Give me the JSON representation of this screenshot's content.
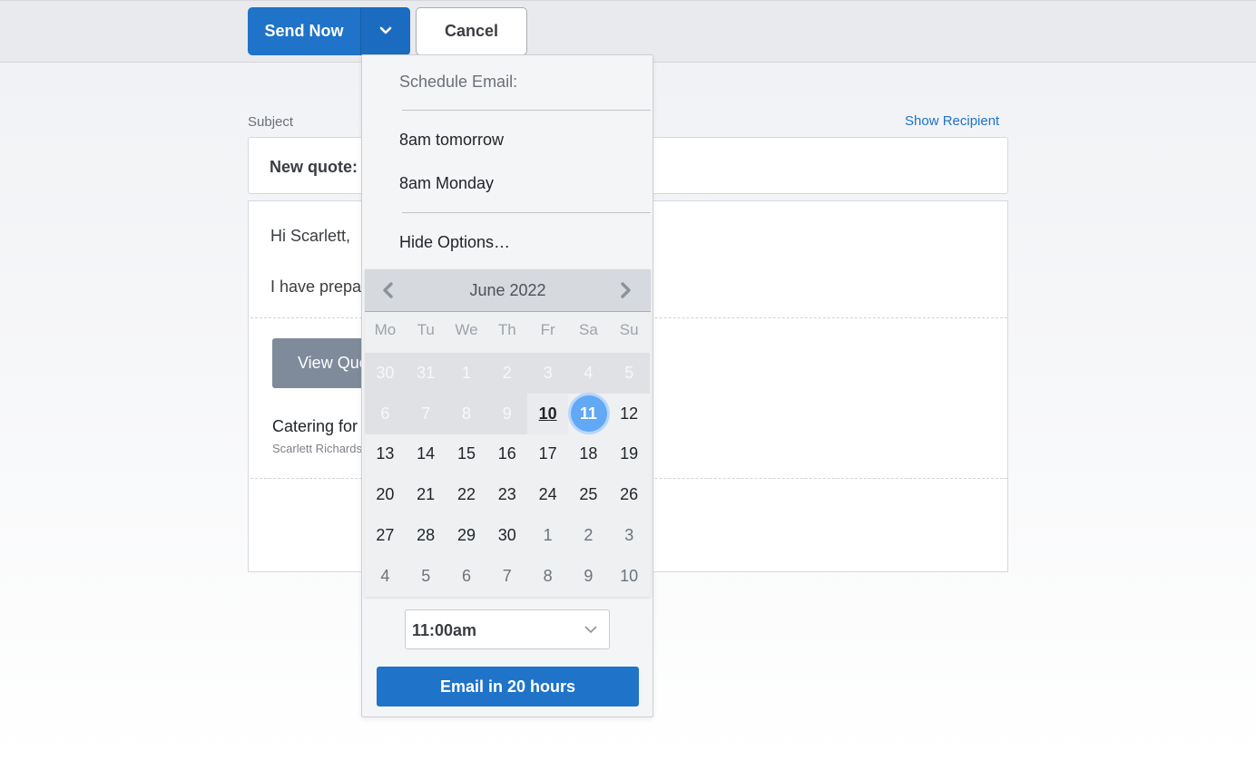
{
  "toolbar": {
    "send_label": "Send Now",
    "cancel_label": "Cancel"
  },
  "compose": {
    "subject_label": "Subject",
    "show_recipient": "Show Recipient",
    "subject_value": "New quote:",
    "greeting": "Hi Scarlett,",
    "intro_text": "I have prepar",
    "view_quote_label": "View Quo",
    "item_title": "Catering for",
    "client_name": "Scarlett Richards"
  },
  "schedule": {
    "heading": "Schedule Email:",
    "options": [
      "8am tomorrow",
      "8am Monday"
    ],
    "hide_options": "Hide Options…",
    "calendar": {
      "title": "June 2022",
      "weekdays": [
        "Mo",
        "Tu",
        "We",
        "Th",
        "Fr",
        "Sa",
        "Su"
      ],
      "days": [
        {
          "label": "30",
          "state": "past"
        },
        {
          "label": "31",
          "state": "past"
        },
        {
          "label": "1",
          "state": "past"
        },
        {
          "label": "2",
          "state": "past"
        },
        {
          "label": "3",
          "state": "past"
        },
        {
          "label": "4",
          "state": "past"
        },
        {
          "label": "5",
          "state": "past"
        },
        {
          "label": "6",
          "state": "past"
        },
        {
          "label": "7",
          "state": "past"
        },
        {
          "label": "8",
          "state": "past"
        },
        {
          "label": "9",
          "state": "past"
        },
        {
          "label": "10",
          "state": "today"
        },
        {
          "label": "11",
          "state": "selected"
        },
        {
          "label": "12",
          "state": "normal"
        },
        {
          "label": "13",
          "state": "normal"
        },
        {
          "label": "14",
          "state": "normal"
        },
        {
          "label": "15",
          "state": "normal"
        },
        {
          "label": "16",
          "state": "normal"
        },
        {
          "label": "17",
          "state": "normal"
        },
        {
          "label": "18",
          "state": "normal"
        },
        {
          "label": "19",
          "state": "normal"
        },
        {
          "label": "20",
          "state": "normal"
        },
        {
          "label": "21",
          "state": "normal"
        },
        {
          "label": "22",
          "state": "normal"
        },
        {
          "label": "23",
          "state": "normal"
        },
        {
          "label": "24",
          "state": "normal"
        },
        {
          "label": "25",
          "state": "normal"
        },
        {
          "label": "26",
          "state": "normal"
        },
        {
          "label": "27",
          "state": "normal"
        },
        {
          "label": "28",
          "state": "normal"
        },
        {
          "label": "29",
          "state": "normal"
        },
        {
          "label": "30",
          "state": "normal"
        },
        {
          "label": "1",
          "state": "other"
        },
        {
          "label": "2",
          "state": "other"
        },
        {
          "label": "3",
          "state": "other"
        },
        {
          "label": "4",
          "state": "other"
        },
        {
          "label": "5",
          "state": "other"
        },
        {
          "label": "6",
          "state": "other"
        },
        {
          "label": "7",
          "state": "other"
        },
        {
          "label": "8",
          "state": "other"
        },
        {
          "label": "9",
          "state": "other"
        },
        {
          "label": "10",
          "state": "other"
        }
      ]
    },
    "time_value": "11:00am",
    "submit_label": "Email in 20 hours"
  },
  "colors": {
    "primary": "#1f73c9",
    "selected_day": "#62a8f5",
    "link": "#1f73c9"
  },
  "icons": {
    "dropdown_caret": "chevron-down-icon",
    "prev_month": "chevron-left-icon",
    "next_month": "chevron-right-icon",
    "time_caret": "chevron-down-icon"
  }
}
